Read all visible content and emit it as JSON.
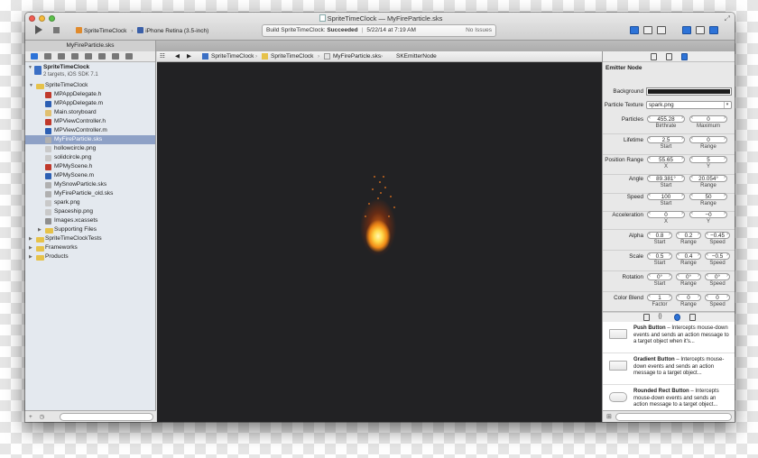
{
  "window": {
    "title": "SpriteTimeClock — MyFireParticle.sks",
    "scheme": "SpriteTimeClock",
    "destination": "iPhone Retina (3.5-inch)",
    "activity_prefix": "Build SpriteTimeClock: ",
    "activity_status": "Succeeded",
    "activity_date": "5/22/14 at 7:19 AM",
    "issues": "No Issues",
    "tab": "MyFireParticle.sks"
  },
  "navigator": {
    "project": "SpriteTimeClock",
    "project_sub": "2 targets, iOS SDK 7.1",
    "items": [
      {
        "label": "SpriteTimeClock",
        "type": "group",
        "indent": 1,
        "open": true
      },
      {
        "label": "MPAppDelegate.h",
        "type": "h",
        "indent": 2
      },
      {
        "label": "MPAppDelegate.m",
        "type": "m",
        "indent": 2
      },
      {
        "label": "Main.storyboard",
        "type": "sb",
        "indent": 2
      },
      {
        "label": "MPViewController.h",
        "type": "h",
        "indent": 2
      },
      {
        "label": "MPViewController.m",
        "type": "m",
        "indent": 2
      },
      {
        "label": "MyFireParticle.sks",
        "type": "sks",
        "indent": 2,
        "selected": true
      },
      {
        "label": "hollowcircle.png",
        "type": "png",
        "indent": 2
      },
      {
        "label": "solidcircle.png",
        "type": "png",
        "indent": 2
      },
      {
        "label": "MPMyScene.h",
        "type": "h",
        "indent": 2
      },
      {
        "label": "MPMyScene.m",
        "type": "m",
        "indent": 2
      },
      {
        "label": "MySnowParticle.sks",
        "type": "sks",
        "indent": 2
      },
      {
        "label": "MyFireParticle_old.sks",
        "type": "sks",
        "indent": 2
      },
      {
        "label": "spark.png",
        "type": "png",
        "indent": 2
      },
      {
        "label": "Spaceship.png",
        "type": "png",
        "indent": 2
      },
      {
        "label": "Images.xcassets",
        "type": "assets",
        "indent": 2
      },
      {
        "label": "Supporting Files",
        "type": "group",
        "indent": 2,
        "open": false
      },
      {
        "label": "SpriteTimeClockTests",
        "type": "group",
        "indent": 1,
        "open": false
      },
      {
        "label": "Frameworks",
        "type": "group",
        "indent": 1,
        "open": false
      },
      {
        "label": "Products",
        "type": "group",
        "indent": 1,
        "open": false
      }
    ]
  },
  "jumpbar": [
    "SpriteTimeClock",
    "SpriteTimeClock",
    "MyFireParticle.sks",
    "SKEmitterNode"
  ],
  "inspector": {
    "header": "Emitter Node",
    "background_label": "Background",
    "texture_label": "Particle Texture",
    "texture_value": "spark.png",
    "particles": {
      "label": "Particles",
      "birthrate": "455.28",
      "birthrate_cap": "Birthrate",
      "maximum": "0",
      "maximum_cap": "Maximum"
    },
    "lifetime": {
      "label": "Lifetime",
      "start": "2.5",
      "range": "0",
      "start_cap": "Start",
      "range_cap": "Range"
    },
    "position_range": {
      "label": "Position Range",
      "x": "55.65",
      "y": "5",
      "x_cap": "X",
      "y_cap": "Y"
    },
    "angle": {
      "label": "Angle",
      "start": "89.381°",
      "range": "20.054°",
      "start_cap": "Start",
      "range_cap": "Range"
    },
    "speed": {
      "label": "Speed",
      "start": "100",
      "range": "50",
      "start_cap": "Start",
      "range_cap": "Range"
    },
    "acceleration": {
      "label": "Acceleration",
      "x": "0",
      "y": "−0",
      "x_cap": "X",
      "y_cap": "Y"
    },
    "alpha": {
      "label": "Alpha",
      "start": "0.8",
      "range": "0.2",
      "speed": "−0.45",
      "start_cap": "Start",
      "range_cap": "Range",
      "speed_cap": "Speed"
    },
    "scale": {
      "label": "Scale",
      "start": "0.5",
      "range": "0.4",
      "speed": "−0.5",
      "start_cap": "Start",
      "range_cap": "Range",
      "speed_cap": "Speed"
    },
    "rotation": {
      "label": "Rotation",
      "start": "0°",
      "range": "0°",
      "speed": "0°",
      "start_cap": "Start",
      "range_cap": "Range",
      "speed_cap": "Speed"
    },
    "color_blend": {
      "label": "Color Blend",
      "factor": "1",
      "range": "0",
      "speed": "0",
      "factor_cap": "Factor",
      "range_cap": "Range",
      "speed_cap": "Speed"
    }
  },
  "library": [
    {
      "name": "Push Button",
      "desc": " – Intercepts mouse-down events and sends an action message to a target object when it's..."
    },
    {
      "name": "Gradient Button",
      "desc": " – Intercepts mouse-down events and sends an action message to a target object..."
    },
    {
      "name": "Rounded Rect Button",
      "desc": " – Intercepts mouse-down events and sends an action message to a target object..."
    }
  ]
}
